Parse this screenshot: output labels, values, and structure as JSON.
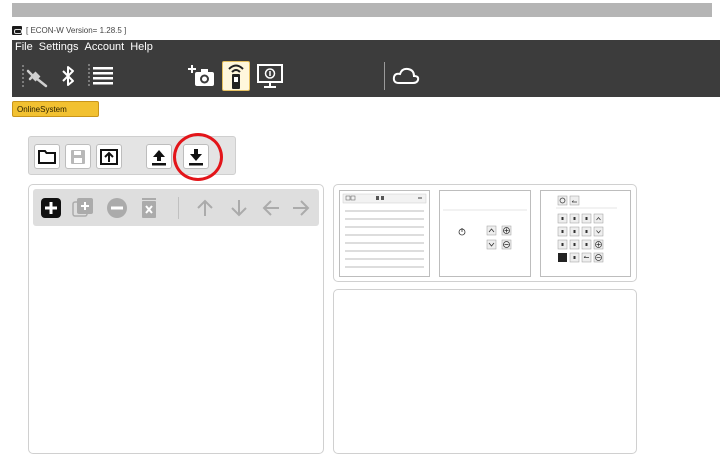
{
  "window": {
    "title": "[ ECON-W Version= 1.28.5 ]"
  },
  "menu": {
    "items": [
      "File",
      "Settings",
      "Account",
      "Help"
    ]
  },
  "toolbar": {
    "icons": [
      "unplug-icon",
      "bluetooth-icon",
      "list-icon",
      "add-camera-icon",
      "remote-icon",
      "monitor-icon",
      "cloud-icon"
    ],
    "active_icon": "remote-icon"
  },
  "tabs": {
    "online_system": "OnlineSystem"
  },
  "file_buttons": {
    "open": "folder-icon",
    "save": "save-icon",
    "export": "export-icon",
    "upload": "upload-icon",
    "download": "download-icon",
    "highlighted": "download-icon"
  },
  "edit_buttons": [
    "add-icon",
    "add-copy-icon",
    "remove-icon",
    "delete-icon",
    "arrow-up-icon",
    "arrow-down-icon",
    "arrow-left-icon",
    "arrow-right-icon"
  ],
  "colors": {
    "menubar_bg": "#3c3c3c",
    "tab_yellow": "#f2c131",
    "highlight_red": "#e3151a"
  }
}
